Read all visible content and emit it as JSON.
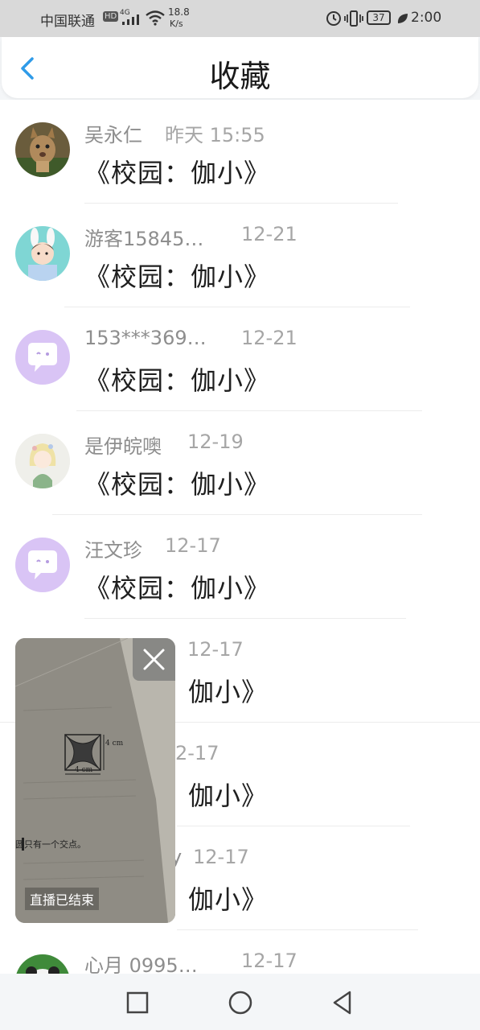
{
  "status_bar": {
    "carrier": "中国联通",
    "hd": "HD",
    "network": "4G",
    "speed_value": "18.8",
    "speed_unit": "K/s",
    "battery": "37",
    "time": "2:00"
  },
  "header": {
    "title": "收藏"
  },
  "items": [
    {
      "name": "吴永仁",
      "date": "昨天 15:55",
      "message": "《校园：伽小》",
      "avatar": "lynx-photo"
    },
    {
      "name": "游客15845…",
      "date": "12-21",
      "message": "《校园：伽小》",
      "avatar": "bunny-ear-girl"
    },
    {
      "name": "153***369…",
      "date": "12-21",
      "message": "《校园：伽小》",
      "avatar": "default-chat-bubble"
    },
    {
      "name": "是伊皖噢",
      "date": "12-19",
      "message": "《校园：伽小》",
      "avatar": "anime-girl"
    },
    {
      "name": "汪文珍",
      "date": "12-17",
      "message": "《校园：伽小》",
      "avatar": "default-chat-bubble"
    },
    {
      "name": "",
      "date": "12-17",
      "message": "伽小》",
      "avatar": ""
    },
    {
      "name": "",
      "date": "2-17",
      "message": "伽小》",
      "avatar": ""
    },
    {
      "name": "y",
      "date": "12-17",
      "message": "伽小》",
      "avatar": ""
    },
    {
      "name": "心月 0995…",
      "date": "12-17",
      "message": "",
      "avatar": "panda-photo"
    }
  ],
  "live_overlay": {
    "status": "直播已结束",
    "figure_label_side": "4 cm",
    "figure_label_bottom": "4 cm",
    "page_text": "圆只有一个交点。"
  },
  "colors": {
    "accent": "#2f9be8",
    "avatar_default": "#d9c4f5"
  }
}
